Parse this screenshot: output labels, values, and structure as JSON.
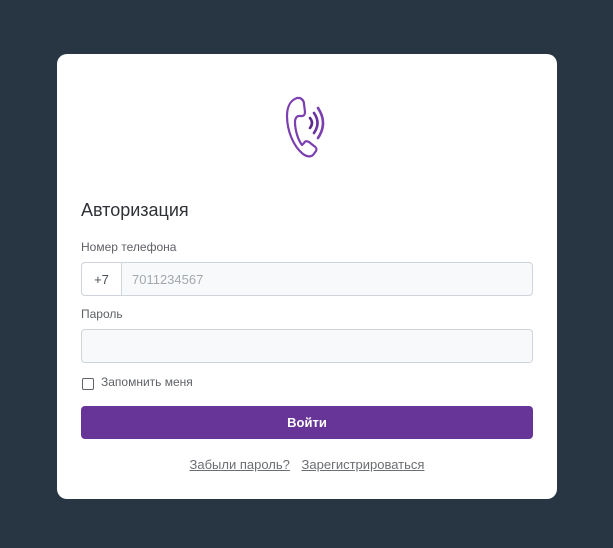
{
  "logo": {
    "icon": "phone-signal-icon",
    "color": "#7b3fb0"
  },
  "auth": {
    "title": "Авторизация",
    "phone_label": "Номер телефона",
    "phone_prefix": "+7",
    "phone_placeholder": "7011234567",
    "password_label": "Пароль",
    "password_value": "",
    "remember_label": "Запомнить меня",
    "remember_checked": false,
    "login_button": "Войти",
    "forgot_link": "Забыли пароль?",
    "register_link": "Зарегистрироваться"
  },
  "colors": {
    "background": "#283644",
    "accent": "#673597"
  }
}
